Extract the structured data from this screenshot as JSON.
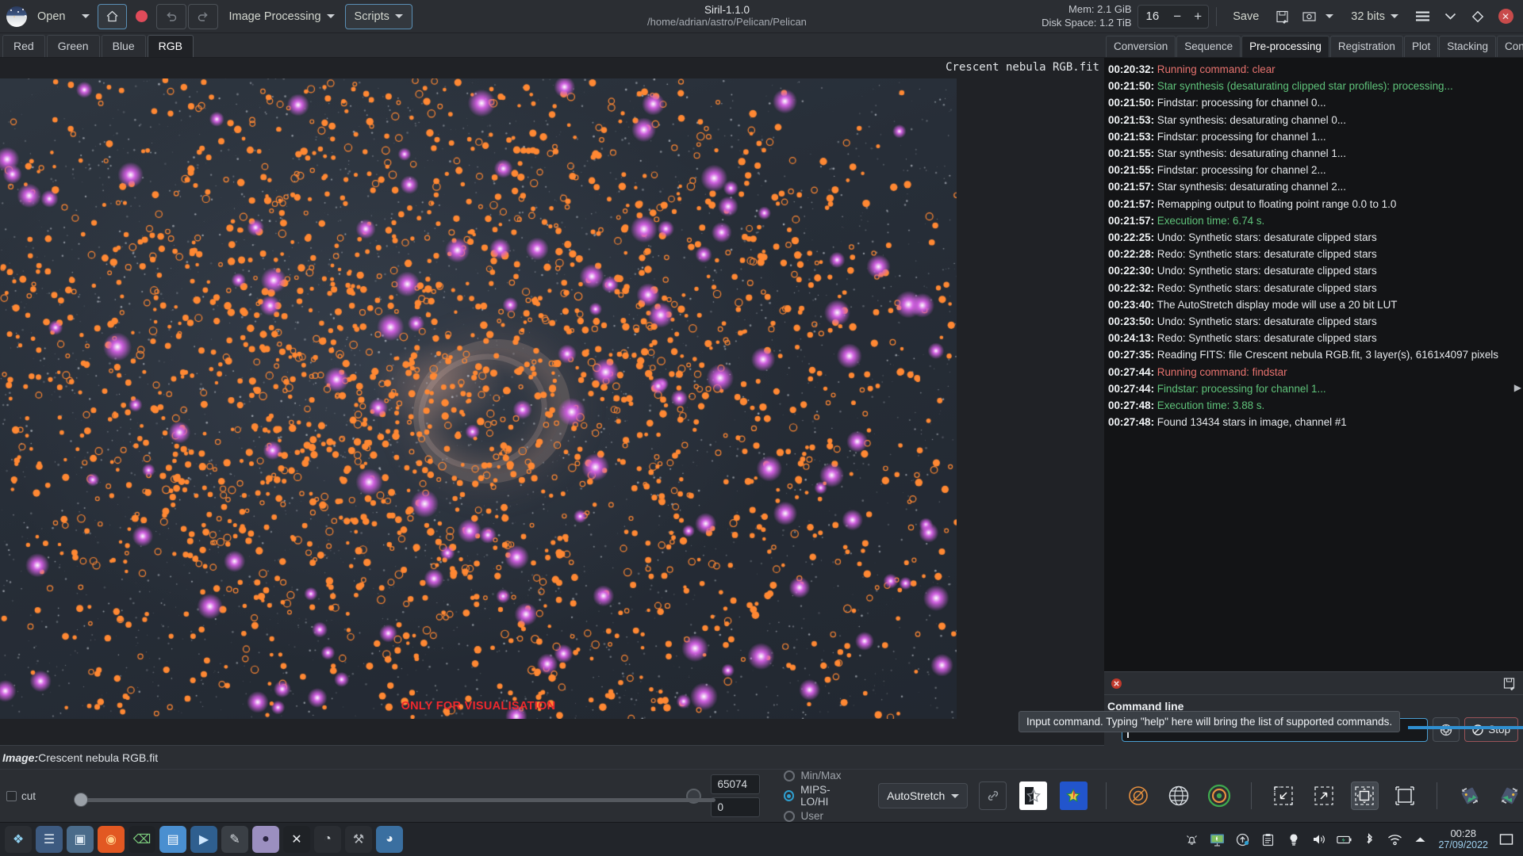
{
  "app": {
    "title": "Siril-1.1.0",
    "path": "/home/adrian/astro/Pelican/Pelican"
  },
  "header": {
    "open_label": "Open",
    "home_icon": "home-icon",
    "record_icon": "record-icon",
    "undo_icon": "undo-icon",
    "redo_icon": "redo-icon",
    "image_processing_label": "Image Processing",
    "scripts_label": "Scripts",
    "mem_label": "Mem: 2.1 GiB",
    "disk_label": "Disk Space: 1.2 TiB",
    "zoom_value": "16",
    "minus_label": "−",
    "plus_label": "+",
    "save_label": "Save",
    "save_as_icon": "save-as-icon",
    "snapshot_icon": "camera-icon",
    "bitdepth_label": "32 bits",
    "hamburger_icon": "hamburger-menu-icon",
    "chevron_icon": "chevron-down-icon",
    "diamond_icon": "diamond-icon",
    "close_icon": "close-icon"
  },
  "channel_tabs": [
    {
      "label": "Red",
      "selected": false
    },
    {
      "label": "Green",
      "selected": false
    },
    {
      "label": "Blue",
      "selected": false
    },
    {
      "label": "RGB",
      "selected": true
    }
  ],
  "canvas": {
    "image_label": "Crescent nebula RGB.fit",
    "watermark": "ONLY FOR VISUALISATION"
  },
  "image_status": {
    "key": "Image:",
    "value": "Crescent nebula RGB.fit"
  },
  "controls": {
    "cut_label": "cut",
    "hi_value": "65074",
    "lo_value": "0",
    "modes": [
      {
        "label": "Min/Max",
        "selected": false
      },
      {
        "label": "MIPS-LO/HI",
        "selected": true
      },
      {
        "label": "User",
        "selected": false
      }
    ],
    "display_mode": "AutoStretch",
    "chain_icon": "chain-link-icon",
    "star_bw_icon": "star-bw-icon",
    "star_color_icon": "star-color-icon",
    "photometry_icon": "photometry-icon",
    "astrometry_icon": "globe-icon",
    "target_icon": "target-icon",
    "zoom_out_icon": "zoom-out-icon",
    "zoom_in_icon": "zoom-in-icon",
    "zoom_fit_icon": "zoom-fit-icon",
    "zoom_one_icon": "zoom-100-icon",
    "rotate_ccw_icon": "rotate-left-icon",
    "rotate_cw_icon": "rotate-right-icon",
    "flip_vertical_icon": "mirror-vertical-icon",
    "flip_horizontal_icon": "mirror-horizontal-icon",
    "stack_icon": "image-stack-icon"
  },
  "right_panel": {
    "tabs": [
      {
        "label": "Conversion",
        "selected": false
      },
      {
        "label": "Sequence",
        "selected": false
      },
      {
        "label": "Pre-processing",
        "selected": true
      },
      {
        "label": "Registration",
        "selected": false
      },
      {
        "label": "Plot",
        "selected": false
      },
      {
        "label": "Stacking",
        "selected": false
      },
      {
        "label": "Console",
        "selected": false
      }
    ],
    "console_lines": [
      {
        "ts": "00:20:32:",
        "msg": "Running command: clear",
        "color": "red"
      },
      {
        "ts": "00:21:50:",
        "msg": "Star synthesis (desaturating clipped star profiles): processing...",
        "color": "green"
      },
      {
        "ts": "00:21:50:",
        "msg": "Findstar: processing for channel 0...",
        "color": "white"
      },
      {
        "ts": "00:21:53:",
        "msg": "Star synthesis: desaturating channel 0...",
        "color": "white"
      },
      {
        "ts": "00:21:53:",
        "msg": "Findstar: processing for channel 1...",
        "color": "white"
      },
      {
        "ts": "00:21:55:",
        "msg": "Star synthesis: desaturating channel 1...",
        "color": "white"
      },
      {
        "ts": "00:21:55:",
        "msg": "Findstar: processing for channel 2...",
        "color": "white"
      },
      {
        "ts": "00:21:57:",
        "msg": "Star synthesis: desaturating channel 2...",
        "color": "white"
      },
      {
        "ts": "00:21:57:",
        "msg": "Remapping output to floating point range 0.0 to 1.0",
        "color": "white"
      },
      {
        "ts": "00:21:57:",
        "msg": "Execution time: 6.74 s.",
        "color": "green"
      },
      {
        "ts": "00:22:25:",
        "msg": "Undo: Synthetic stars: desaturate clipped stars",
        "color": "white"
      },
      {
        "ts": "00:22:28:",
        "msg": "Redo: Synthetic stars: desaturate clipped stars",
        "color": "white"
      },
      {
        "ts": "00:22:30:",
        "msg": "Undo: Synthetic stars: desaturate clipped stars",
        "color": "white"
      },
      {
        "ts": "00:22:32:",
        "msg": "Redo: Synthetic stars: desaturate clipped stars",
        "color": "white"
      },
      {
        "ts": "00:23:40:",
        "msg": "The AutoStretch display mode will use a 20 bit LUT",
        "color": "white"
      },
      {
        "ts": "00:23:50:",
        "msg": "Undo: Synthetic stars: desaturate clipped stars",
        "color": "white"
      },
      {
        "ts": "00:24:13:",
        "msg": "Redo: Synthetic stars: desaturate clipped stars",
        "color": "white"
      },
      {
        "ts": "00:27:35:",
        "msg": "Reading FITS: file Crescent nebula RGB.fit, 3 layer(s), 6161x4097 pixels",
        "color": "white"
      },
      {
        "ts": "00:27:44:",
        "msg": "Running command: findstar",
        "color": "red"
      },
      {
        "ts": "00:27:44:",
        "msg": "Findstar: processing for channel 1...",
        "color": "green"
      },
      {
        "ts": "00:27:48:",
        "msg": "Execution time: 3.88 s.",
        "color": "green"
      },
      {
        "ts": "00:27:48:",
        "msg": "Found 13434 stars in image, channel #1",
        "color": "white"
      }
    ],
    "clear_console_icon": "clear-console-icon",
    "export_log_icon": "export-log-icon",
    "command_line_label": "Command line",
    "command_input_value": "",
    "command_input_placeholder": "",
    "command_help_icon": "command-help-icon",
    "stop_label": "Stop",
    "stop_icon": "stop-icon",
    "tooltip": "Input command. Typing \"help\" here will bring the list of supported commands."
  },
  "taskbar": {
    "apps": [
      {
        "name": "launcher-icon",
        "glyph": "❖",
        "bg": "#2b2e33",
        "fg": "#8fd0f0"
      },
      {
        "name": "files-icon",
        "glyph": "☰",
        "bg": "#3d5a80",
        "fg": "#e8f0f7"
      },
      {
        "name": "toolbox-icon",
        "glyph": "▣",
        "bg": "#4a6b8a",
        "fg": "#dce8f2"
      },
      {
        "name": "firefox-icon",
        "glyph": "◉",
        "bg": "#e25822",
        "fg": "#ffd08a"
      },
      {
        "name": "terminal-icon",
        "glyph": "⌫",
        "bg": "#1f2226",
        "fg": "#7ed07e"
      },
      {
        "name": "file-manager-icon",
        "glyph": "▤",
        "bg": "#4a8fd0",
        "fg": "#ffffff"
      },
      {
        "name": "media-icon",
        "glyph": "▶",
        "bg": "#2f5f8f",
        "fg": "#cfe8ff"
      },
      {
        "name": "editor-icon",
        "glyph": "✎",
        "bg": "#3a3f45",
        "fg": "#d8dde2"
      },
      {
        "name": "siril-icon",
        "glyph": "●",
        "bg": "#9b8fc0",
        "fg": "#2a2440"
      },
      {
        "name": "xnview-icon",
        "glyph": "✕",
        "bg": "#1f2226",
        "fg": "#e8ebee"
      },
      {
        "name": "owl-icon",
        "glyph": "◔",
        "bg": "#2a2d32",
        "fg": "#cfd3d7"
      },
      {
        "name": "tools-icon",
        "glyph": "⚒",
        "bg": "#2a2d32",
        "fg": "#b8bcc1"
      },
      {
        "name": "gimp-icon",
        "glyph": "◕",
        "bg": "#3a6fa0",
        "fg": "#eaf2f8"
      }
    ],
    "sys_icons": [
      "notifications-icon",
      "display-icon",
      "update-icon",
      "clipboard-icon",
      "brightness-icon",
      "volume-icon",
      "battery-icon",
      "bluetooth-icon",
      "wifi-icon",
      "show-hidden-icon"
    ],
    "time": "00:28",
    "date": "27/09/2022",
    "show_desktop_icon": "show-desktop-icon"
  },
  "colors": {
    "accent": "#2f8fd0",
    "log_red": "#e8736f",
    "log_green": "#5fc37a",
    "watermark": "#f0282d",
    "star_orange": "#ff8833",
    "star_magenta": "#d060e0"
  }
}
